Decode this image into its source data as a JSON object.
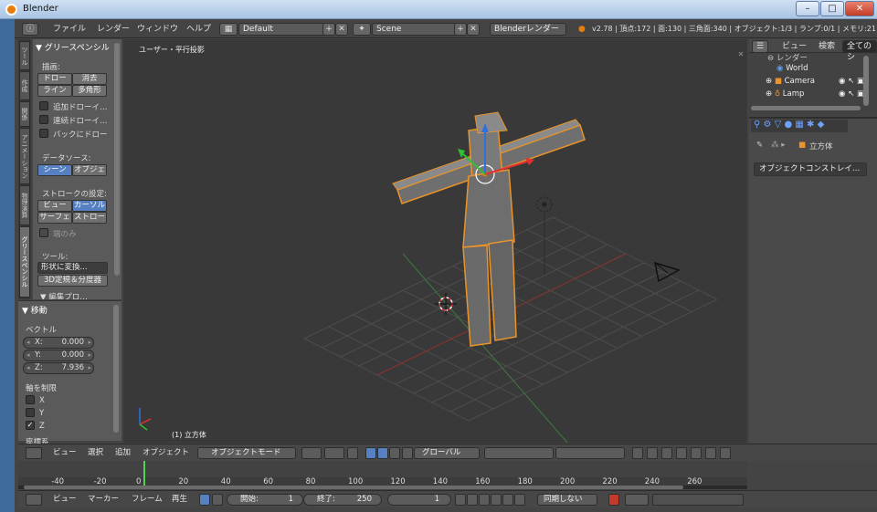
{
  "window": {
    "title": "Blender"
  },
  "menu": {
    "items": [
      "ファイル",
      "レンダー",
      "ウィンドウ",
      "ヘルプ"
    ]
  },
  "topbar": {
    "layout": "Default",
    "scene": "Scene",
    "render_engine": "Blenderレンダー",
    "stats": "v2.78 | 頂点:172 | 面:130 | 三角面:340 | オブジェクト:1/3 | ランプ:0/1 | メモリ:21"
  },
  "tabs": [
    "ツール",
    "作成",
    "関係",
    "アニメーション",
    "物理演算",
    "グリースペンシル"
  ],
  "toolshelf": {
    "panel_title": "▼ グリースペンシル",
    "draw_label": "描画:",
    "draw_btn": "ドロー",
    "erase_btn": "消去",
    "line_btn": "ライン",
    "poly_btn": "多角形",
    "check1": "追加ドローイ…",
    "check2": "連続ドローイ…",
    "check3": "バックにドロー",
    "source_label": "データソース:",
    "scene_btn": "シーン",
    "object_btn": "オブジェ",
    "stroke_label": "ストロークの設定:",
    "view_btn": "ビュー",
    "cursor_btn": "カーソル",
    "surface_btn": "サーフェ",
    "stroke_btn": "ストロー",
    "only_label": "端のみ",
    "tools_label": "ツール:",
    "shape_btn": "形状に変換...",
    "surgery_btn": "3D定規＆分度器",
    "extra": "▼ 編集プロ…"
  },
  "operator": {
    "title": "▼ 移動",
    "vector_label": "ベクトル",
    "x_label": "X:",
    "x_value": "0.000",
    "y_label": "Y:",
    "y_value": "0.000",
    "z_label": "Z:",
    "z_value": "7.936",
    "constraint_label": "軸を制限",
    "ax_x": "X",
    "ax_y": "Y",
    "ax_z": "Z",
    "coord_label": "座標系"
  },
  "viewport": {
    "view_label": "ユーザー・平行投影",
    "object_label": "(1) 立方体"
  },
  "outliner": {
    "view": "ビュー",
    "search": "検索",
    "all": "全てのシ",
    "rows": [
      "レンダー",
      "World",
      "Camera",
      "Lamp"
    ]
  },
  "properties": {
    "breadcrumb": "立方体",
    "dropdown": "オブジェクトコンストレイ…"
  },
  "view3d_header": {
    "view": "ビュー",
    "select": "選択",
    "add": "追加",
    "object": "オブジェクト",
    "mode": "オブジェクトモード",
    "orientation": "グローバル"
  },
  "timeline": {
    "ticks": [
      -40,
      -20,
      0,
      20,
      40,
      60,
      80,
      100,
      120,
      140,
      160,
      180,
      200,
      220,
      240,
      260
    ],
    "current_frame": 1
  },
  "timeline_header": {
    "view": "ビュー",
    "marker": "マーカー",
    "frame": "フレーム",
    "play": "再生",
    "start_label": "開始:",
    "start_value": "1",
    "end_label": "終了:",
    "end_value": "250",
    "current_value": "1",
    "sync": "同期しない"
  }
}
